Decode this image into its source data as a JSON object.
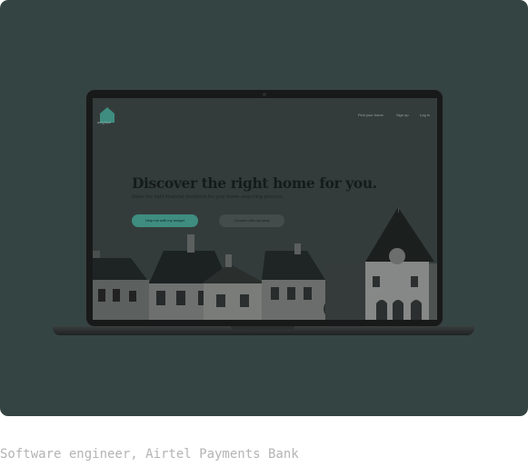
{
  "website": {
    "logo_text": "neighbor",
    "nav": {
      "find_your_home": "Find your home",
      "sign_up": "Sign up",
      "log_in": "Log in"
    },
    "hero": {
      "title": "Discover the right home for you.",
      "subtitle": "Make the right financial decisions for your home searching process.",
      "primary_button": "Help me with my budget",
      "secondary_button": "Connect with my bank"
    }
  },
  "caption": "Software engineer, Airtel Payments Bank",
  "colors": {
    "card_background": "#344442",
    "accent": "#3e8d80",
    "caption_text": "#b4b4b4"
  }
}
